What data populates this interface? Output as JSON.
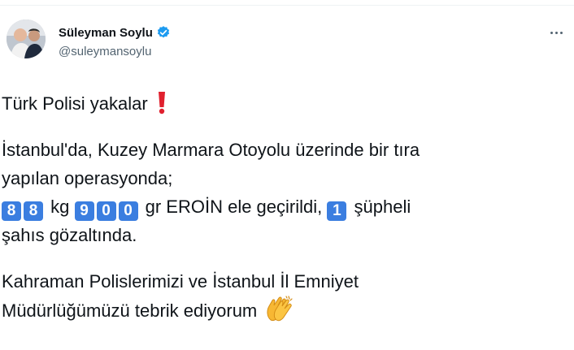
{
  "author": {
    "name": "Süleyman Soylu",
    "handle": "@suleymansoylu"
  },
  "icons": {
    "verified": "verified-badge-icon",
    "more": "more-options-icon",
    "exclamation": "red-exclamation-icon",
    "clapping": "clapping-hands-icon"
  },
  "colors": {
    "verified": "#1d9bf0",
    "keycap": "#3b7ee0",
    "exclamation": "#e0202e",
    "clap": "#f7b733"
  },
  "tweet": {
    "line1": "Türk Polisi yakalar",
    "line2": "İstanbul'da, Kuzey Marmara Otoyolu üzerinde bir tıra",
    "line3": "yapılan operasyonda;",
    "seizure": {
      "kg_digits": [
        "8",
        "8"
      ],
      "kg_unit": "kg",
      "gr_digits": [
        "9",
        "0",
        "0"
      ],
      "gr_text": "gr EROİN ele geçirildi,",
      "suspect_digit": "1",
      "suspect_text": "şüpheli"
    },
    "line5": "şahıs gözaltında.",
    "line6": "Kahraman Polislerimizi ve İstanbul İl Emniyet",
    "line7": "Müdürlüğümüzü tebrik ediyorum"
  }
}
